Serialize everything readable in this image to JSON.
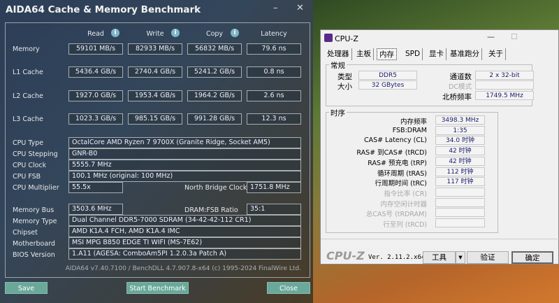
{
  "aida": {
    "title": "AIDA64 Cache & Memory Benchmark",
    "minimize": "–",
    "close_x": "✕",
    "columns": [
      "Read",
      "Write",
      "Copy",
      "Latency"
    ],
    "info_icon": "i",
    "rows": [
      {
        "label": "Memory",
        "values": [
          "59101 MB/s",
          "82933 MB/s",
          "56832 MB/s",
          "79.6 ns"
        ]
      },
      {
        "label": "L1 Cache",
        "values": [
          "5436.4 GB/s",
          "2740.4 GB/s",
          "5241.2 GB/s",
          "0.8 ns"
        ]
      },
      {
        "label": "L2 Cache",
        "values": [
          "1927.0 GB/s",
          "1953.4 GB/s",
          "1964.2 GB/s",
          "2.6 ns"
        ]
      },
      {
        "label": "L3 Cache",
        "values": [
          "1023.3 GB/s",
          "985.15 GB/s",
          "991.28 GB/s",
          "12.3 ns"
        ]
      }
    ],
    "cpu_type": {
      "label": "CPU Type",
      "value": "OctalCore AMD Ryzen 7 9700X  (Granite Ridge, Socket AM5)"
    },
    "cpu_stepping": {
      "label": "CPU Stepping",
      "value": "GNR-B0"
    },
    "cpu_clock": {
      "label": "CPU Clock",
      "value": "5555.7 MHz"
    },
    "cpu_fsb": {
      "label": "CPU FSB",
      "value": "100.1 MHz  (original: 100 MHz)"
    },
    "cpu_multiplier": {
      "label": "CPU Multiplier",
      "value": "55.5x"
    },
    "nb_clock": {
      "label": "North Bridge Clock",
      "value": "1751.8 MHz"
    },
    "memory_bus": {
      "label": "Memory Bus",
      "value": "3503.6 MHz"
    },
    "dram_ratio": {
      "label": "DRAM:FSB Ratio",
      "value": "35:1"
    },
    "memory_type": {
      "label": "Memory Type",
      "value": "Dual Channel DDR5-7000 SDRAM  (34-42-42-112 CR1)"
    },
    "chipset": {
      "label": "Chipset",
      "value": "AMD K1A.4 FCH, AMD K1A.4 IMC"
    },
    "motherboard": {
      "label": "Motherboard",
      "value": "MSI MPG B850 EDGE TI WIFI (MS-7E62)"
    },
    "bios": {
      "label": "BIOS Version",
      "value": "1.A11  (AGESA: ComboAm5PI 1.2.0.3a Patch A)"
    },
    "footer": "AIDA64 v7.40.7100 / BenchDLL 4.7.907.8-x64  (c) 1995-2024 FinalWire Ltd.",
    "buttons": {
      "save": "Save",
      "start": "Start Benchmark",
      "close": "Close"
    }
  },
  "cpuz": {
    "title": "CPU-Z",
    "minimize": "—",
    "maximize": "☐",
    "tabs": [
      "处理器",
      "主板",
      "内存",
      "SPD",
      "显卡",
      "基准跑分",
      "关于"
    ],
    "general": {
      "title": "常规",
      "type_label": "类型",
      "type": "DDR5",
      "size_label": "大小",
      "size": "32 GBytes",
      "channels_label": "通道数",
      "channels": "2 x 32-bit",
      "dc_label": "DC模式",
      "nb_label": "北桥频率",
      "nb": "1749.5 MHz"
    },
    "timings": {
      "title": "时序",
      "rows": [
        {
          "label": "内存频率",
          "value": "3498.3 MHz"
        },
        {
          "label": "FSB:DRAM",
          "value": "1:35"
        },
        {
          "label": "CAS# Latency (CL)",
          "value": "34.0 时钟"
        },
        {
          "label": "RAS# 到CAS# (tRCD)",
          "value": "42 时钟"
        },
        {
          "label": "RAS# 预充电 (tRP)",
          "value": "42 时钟"
        },
        {
          "label": "循环周期 (tRAS)",
          "value": "112 时钟"
        },
        {
          "label": "行周期时间 (tRC)",
          "value": "117 时钟"
        },
        {
          "label": "指令比率 (CR)",
          "value": ""
        },
        {
          "label": "内存空闲计时器",
          "value": ""
        },
        {
          "label": "总CAS号 (tRDRAM)",
          "value": ""
        },
        {
          "label": "行至列 (tRCD)",
          "value": ""
        }
      ]
    },
    "logo": "CPU-Z",
    "version": "Ver. 2.11.2.x64",
    "tools": "工具",
    "validate": "验证",
    "ok": "确定"
  }
}
